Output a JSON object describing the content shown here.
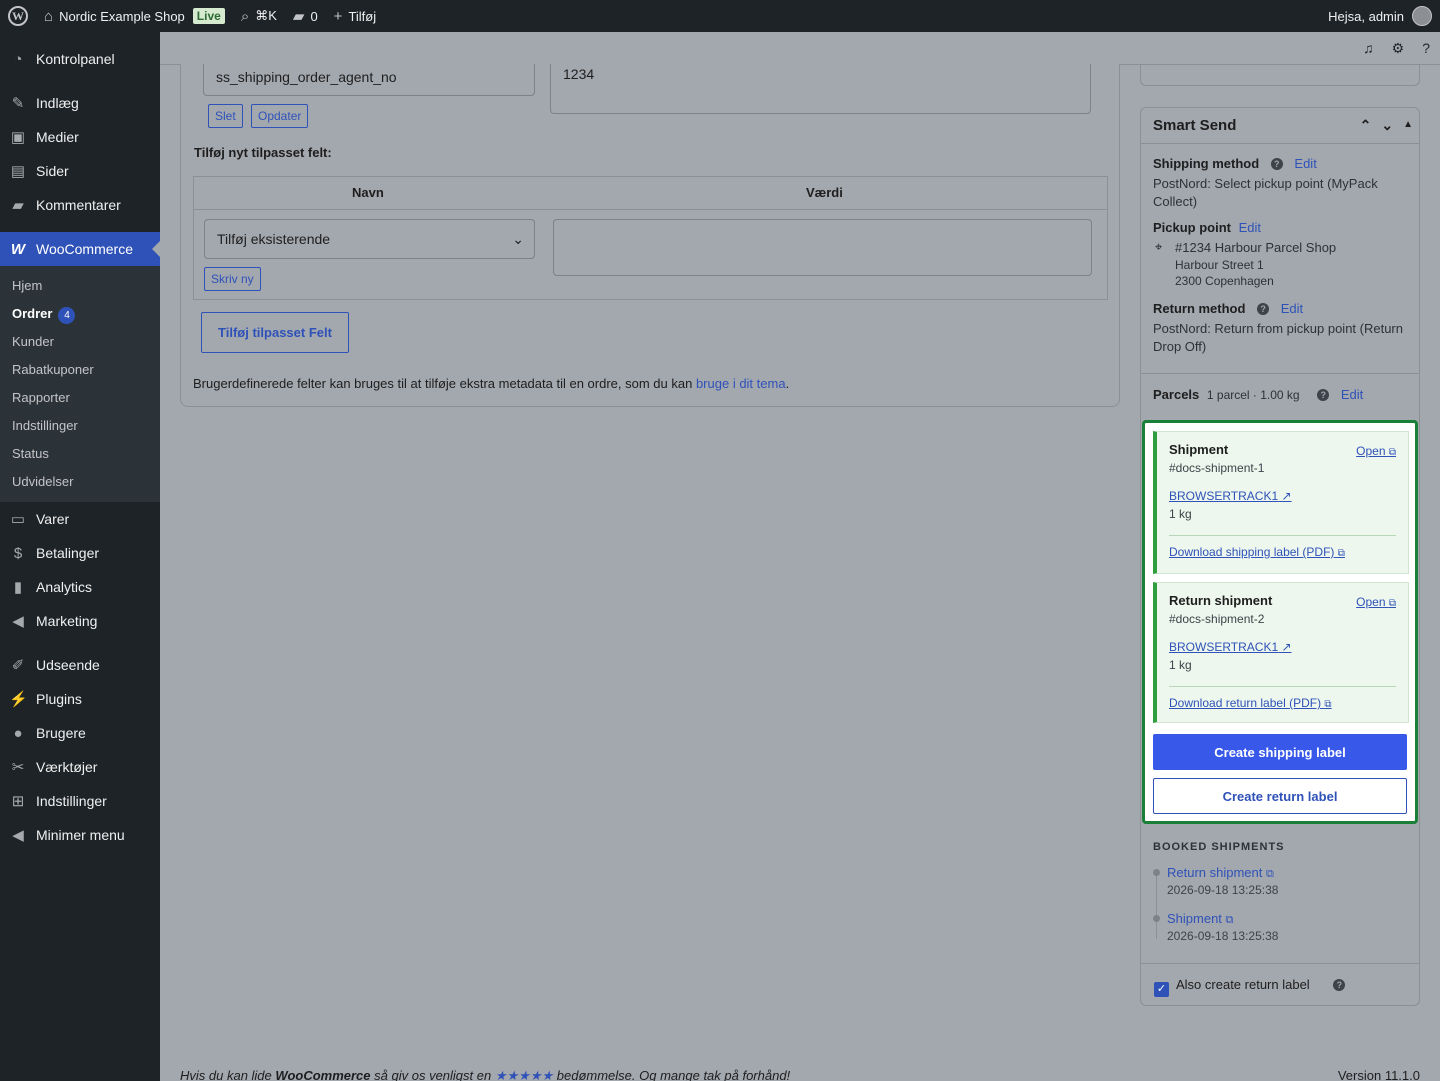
{
  "adminbar": {
    "site_name": "Nordic Example Shop",
    "live_badge": "Live",
    "search_shortcut": "⌘K",
    "comments_count": "0",
    "new_label": "Tilføj",
    "greeting": "Hejsa, admin"
  },
  "sidebar": {
    "top_items": [
      {
        "label": "Kontrolpanel",
        "icon": "dashboard-icon"
      },
      {
        "label": "Indlæg",
        "icon": "pin-icon"
      },
      {
        "label": "Medier",
        "icon": "media-icon"
      },
      {
        "label": "Sider",
        "icon": "pages-icon"
      },
      {
        "label": "Kommentarer",
        "icon": "comment-icon"
      },
      {
        "label": "WooCommerce",
        "icon": "woo-icon"
      }
    ],
    "woo_sub": [
      "Hjem",
      "Ordrer",
      "Kunder",
      "Rabatkuponer",
      "Rapporter",
      "Indstillinger",
      "Status",
      "Udvidelser"
    ],
    "orders_badge": "4",
    "bottom_items": [
      {
        "label": "Varer",
        "icon": "products-icon"
      },
      {
        "label": "Betalinger",
        "icon": "payments-icon"
      },
      {
        "label": "Analytics",
        "icon": "analytics-icon"
      },
      {
        "label": "Marketing",
        "icon": "megaphone-icon"
      },
      {
        "label": "Udseende",
        "icon": "brush-icon"
      },
      {
        "label": "Plugins",
        "icon": "plugin-icon"
      },
      {
        "label": "Brugere",
        "icon": "user-icon"
      },
      {
        "label": "Værktøjer",
        "icon": "wrench-icon"
      },
      {
        "label": "Indstillinger",
        "icon": "settings-icon"
      },
      {
        "label": "Minimer menu",
        "icon": "collapse-icon"
      }
    ]
  },
  "custom_fields": {
    "existing_key": "ss_shipping_order_agent_no",
    "existing_value": "1234",
    "delete_label": "Slet",
    "update_label": "Opdater",
    "add_new_heading": "Tilføj nyt tilpasset felt:",
    "col_name": "Navn",
    "col_value": "Værdi",
    "select_value": "Tilføj eksisterende",
    "enter_new_label": "Skriv ny",
    "add_button": "Tilføj tilpasset Felt",
    "description": "Brugerdefinerede felter kan bruges til at tilføje ekstra metadata til en ordre, som du kan",
    "description_link": "bruge i dit tema",
    "description_end": "."
  },
  "smart_send": {
    "title": "Smart Send",
    "edit_label": "Edit",
    "shipping_method_label": "Shipping method",
    "shipping_method_value": "PostNord: Select pickup point (MyPack Collect)",
    "pickup_point_label": "Pickup point",
    "pickup_name": "#1234 Harbour Parcel Shop",
    "pickup_street": "Harbour Street 1",
    "pickup_city": "2300 Copenhagen",
    "return_method_label": "Return method",
    "return_method_value": "PostNord: Return from pickup point (Return Drop Off)",
    "parcels_label": "Parcels",
    "parcels_value": "1 parcel · 1.00 kg",
    "shipments": [
      {
        "title": "Shipment",
        "id": "#docs-shipment-1",
        "open": "Open",
        "track": "BROWSERTRACK1",
        "weight": "1 kg",
        "download": "Download shipping label (PDF)"
      },
      {
        "title": "Return shipment",
        "id": "#docs-shipment-2",
        "open": "Open",
        "track": "BROWSERTRACK1",
        "weight": "1 kg",
        "download": "Download return label (PDF)"
      }
    ],
    "create_shipping_label": "Create shipping label",
    "create_return_label": "Create return label",
    "booked_heading": "BOOKED SHIPMENTS",
    "booked": [
      {
        "label": "Return shipment",
        "time": "2026-09-18 13:25:38"
      },
      {
        "label": "Shipment",
        "time": "2026-09-18 13:25:38"
      }
    ],
    "also_return_label": "Also create return label"
  },
  "footer": {
    "text_pre": "Hvis du kan lide",
    "brand": "WooCommerce",
    "text_mid": "så giv os venligst en",
    "stars": "★★★★★",
    "text_post": "bedømmelse. Og mange tak på forhånd!",
    "version": "Version 11.1.0"
  },
  "colors": {
    "accent": "#2f52b8",
    "primary_button": "#3858e9",
    "success_border": "#1a7f37",
    "sidebar_bg": "#1d2327"
  }
}
